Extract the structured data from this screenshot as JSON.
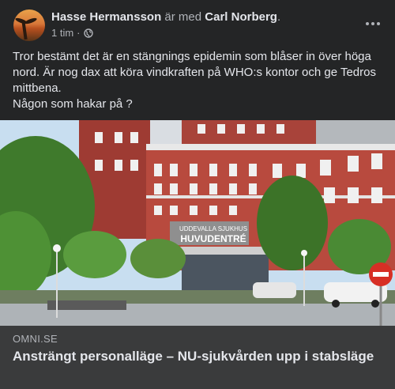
{
  "post": {
    "author": "Hasse Hermansson",
    "with_text": "är med",
    "tagged": "Carl Norberg",
    "period": ".",
    "time": "1 tim",
    "separator": "·",
    "text_line1": "Tror bestämt det är en stängnings epidemin som blåser in över höga nord. Är nog dax att köra vindkraften på WHO:s kontor och ge Tedros mittbena.",
    "text_line2": "Någon som hakar på ?"
  },
  "icons": {
    "privacy": "globe-icon",
    "more": "more-options-icon"
  },
  "photo": {
    "sign_line1": "UDDEVALLA SJUKHUS",
    "sign_line2": "HUVUDENTRÉ"
  },
  "link": {
    "domain": "OMNI.SE",
    "title": "Ansträngt personalläge – NU-sjukvården upp i stabsläge"
  },
  "colors": {
    "background": "#242526",
    "link_box": "#3a3b3c",
    "primary_text": "#e4e6eb",
    "secondary_text": "#b0b3b8"
  }
}
